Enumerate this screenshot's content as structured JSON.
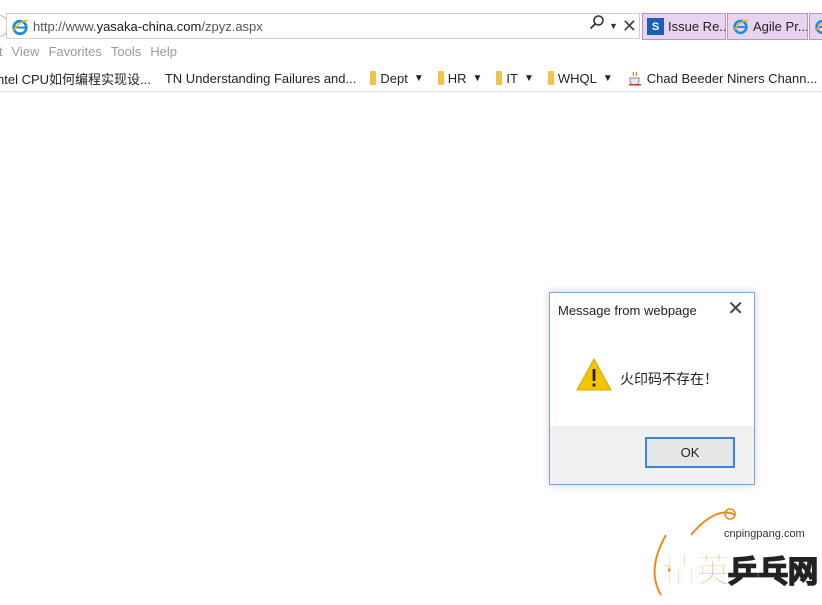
{
  "address_bar": {
    "url_prefix": "http://www.",
    "url_domain": "yasaka-china.com",
    "url_path": "/zpyz.aspx",
    "search_glyph": "⚲",
    "dropdown_glyph": "▼",
    "close_glyph": "✕"
  },
  "tabs": [
    {
      "label": "Issue Re...",
      "icon": "sharepoint-icon",
      "icon_text": "S"
    },
    {
      "label": "Agile Pr...",
      "icon": "ie-icon"
    },
    {
      "label": "",
      "icon": "ie-icon"
    }
  ],
  "menu": {
    "items": [
      "it",
      "View",
      "Favorites",
      "Tools",
      "Help"
    ]
  },
  "favorites": {
    "items": [
      {
        "label": "ntel CPU如何编程实现设...",
        "folder": false,
        "dropdown": false
      },
      {
        "label": "TN Understanding Failures and...",
        "folder": false,
        "dropdown": false
      },
      {
        "label": "Dept",
        "folder": true,
        "dropdown": true
      },
      {
        "label": "HR",
        "folder": true,
        "dropdown": true
      },
      {
        "label": "IT",
        "folder": true,
        "dropdown": true
      },
      {
        "label": "WHQL",
        "folder": true,
        "dropdown": true
      },
      {
        "label": "Chad Beeder Niners Chann...",
        "folder": false,
        "dropdown": false
      }
    ],
    "caret": "▼"
  },
  "dialog": {
    "title": "Message from webpage",
    "close_glyph": "✕",
    "message": "火印码不存在！",
    "ok_label": "OK",
    "icon": "warning-icon"
  },
  "watermark": {
    "url": "cnpingpang.com",
    "text_a": "精英",
    "text_b": "乒乓网"
  },
  "colors": {
    "tab_bg": "#e8d4f0",
    "dialog_border": "#7ea7d8",
    "ok_border": "#3f84d2",
    "folder": "#f0c34b",
    "warning": "#f5c400",
    "watermark_orange": "#f08a1c"
  }
}
